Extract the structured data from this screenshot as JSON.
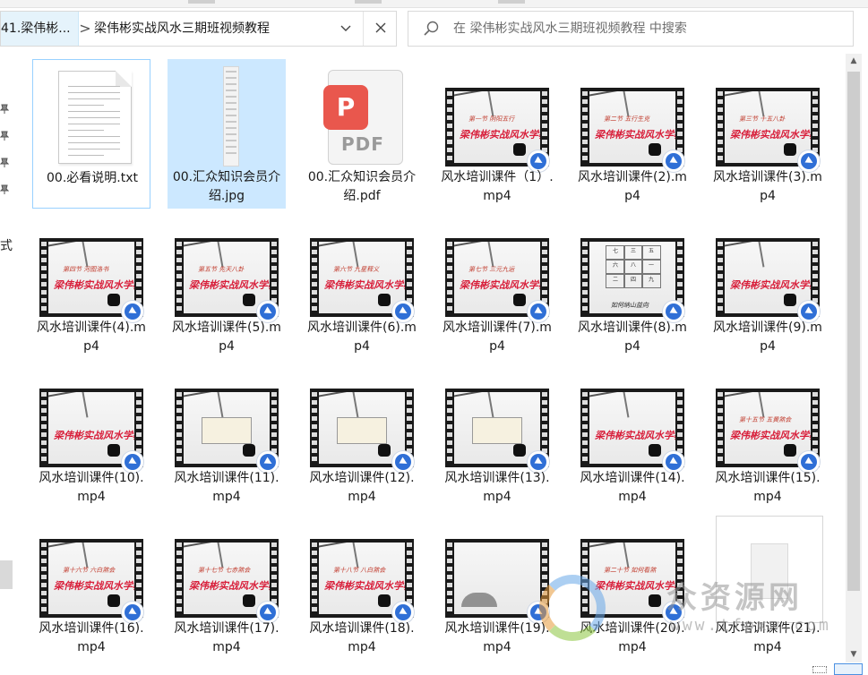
{
  "address": {
    "crumb_prefix": "41.梁伟彬...",
    "separator": ">",
    "current_folder": "梁伟彬实战风水三期班视频教程",
    "dropdown_icon": "chevron-down-icon",
    "clear_icon": "close-icon"
  },
  "search": {
    "placeholder": "在 梁伟彬实战风水三期班视频教程 中搜索",
    "icon": "search-icon"
  },
  "nav": {
    "truncated_text": "式",
    "pin_icon": "pin-icon"
  },
  "files": [
    {
      "name": "00.必看说明.txt",
      "kind": "txt"
    },
    {
      "name": "00.汇众知识会员介绍.jpg",
      "kind": "jpg"
    },
    {
      "name": "00.汇众知识会员介绍.pdf",
      "kind": "pdf",
      "badge": "P",
      "badge_text": "PDF"
    },
    {
      "name": "风水培训课件（1）.mp4",
      "kind": "video"
    },
    {
      "name": "风水培训课件(2).mp4",
      "kind": "video"
    },
    {
      "name": "风水培训课件(3).mp4",
      "kind": "video"
    },
    {
      "name": "风水培训课件(4).mp4",
      "kind": "video"
    },
    {
      "name": "风水培训课件(5).mp4",
      "kind": "video"
    },
    {
      "name": "风水培训课件(6).mp4",
      "kind": "video"
    },
    {
      "name": "风水培训课件(7).mp4",
      "kind": "video"
    },
    {
      "name": "风水培训课件(8).mp4",
      "kind": "video-grid"
    },
    {
      "name": "风水培训课件(9).mp4",
      "kind": "video"
    },
    {
      "name": "风水培训课件(10).mp4",
      "kind": "video"
    },
    {
      "name": "风水培训课件(11).mp4",
      "kind": "video-screen"
    },
    {
      "name": "风水培训课件(12).mp4",
      "kind": "video-screen"
    },
    {
      "name": "风水培训课件(13).mp4",
      "kind": "video-screen"
    },
    {
      "name": "风水培训课件(14).mp4",
      "kind": "video"
    },
    {
      "name": "风水培训课件(15).mp4",
      "kind": "video"
    },
    {
      "name": "风水培训课件(16).mp4",
      "kind": "video"
    },
    {
      "name": "风水培训课件(17).mp4",
      "kind": "video"
    },
    {
      "name": "风水培训课件(18).mp4",
      "kind": "video"
    },
    {
      "name": "风水培训课件(19).mp4",
      "kind": "video-landscape"
    },
    {
      "name": "风水培训课件(20).mp4",
      "kind": "video"
    },
    {
      "name": "风水培训课件(21).mp4",
      "kind": "blank"
    }
  ],
  "thumb_text": {
    "headings": [
      "第一节 阴阳五行",
      "第二节 五行生克",
      "第三节 十五八卦",
      "第四节 河图洛书",
      "第五节 先天八卦",
      "第六节 九星释义",
      "第七节 三元九运",
      "如何纳山益向",
      "",
      "",
      "",
      "",
      "",
      "",
      "第十五节 五黄煞会",
      "第十六节 六白煞会",
      "第十七节 七赤煞会",
      "第十八节 八白煞会",
      "",
      "第二十节 如何看煞"
    ],
    "main_title": "梁伟彬实战风水学教程",
    "grid_cells": [
      "七",
      "三",
      "五",
      "六",
      "八",
      "一",
      "二",
      "四",
      "九"
    ]
  },
  "watermark": {
    "text": "众资源网",
    "url": "www.tfpxw.com"
  },
  "colors": {
    "selection": "#cce8ff",
    "accent": "#2f6fd6",
    "video_red": "#d81e3a",
    "watermark": "#969696"
  }
}
